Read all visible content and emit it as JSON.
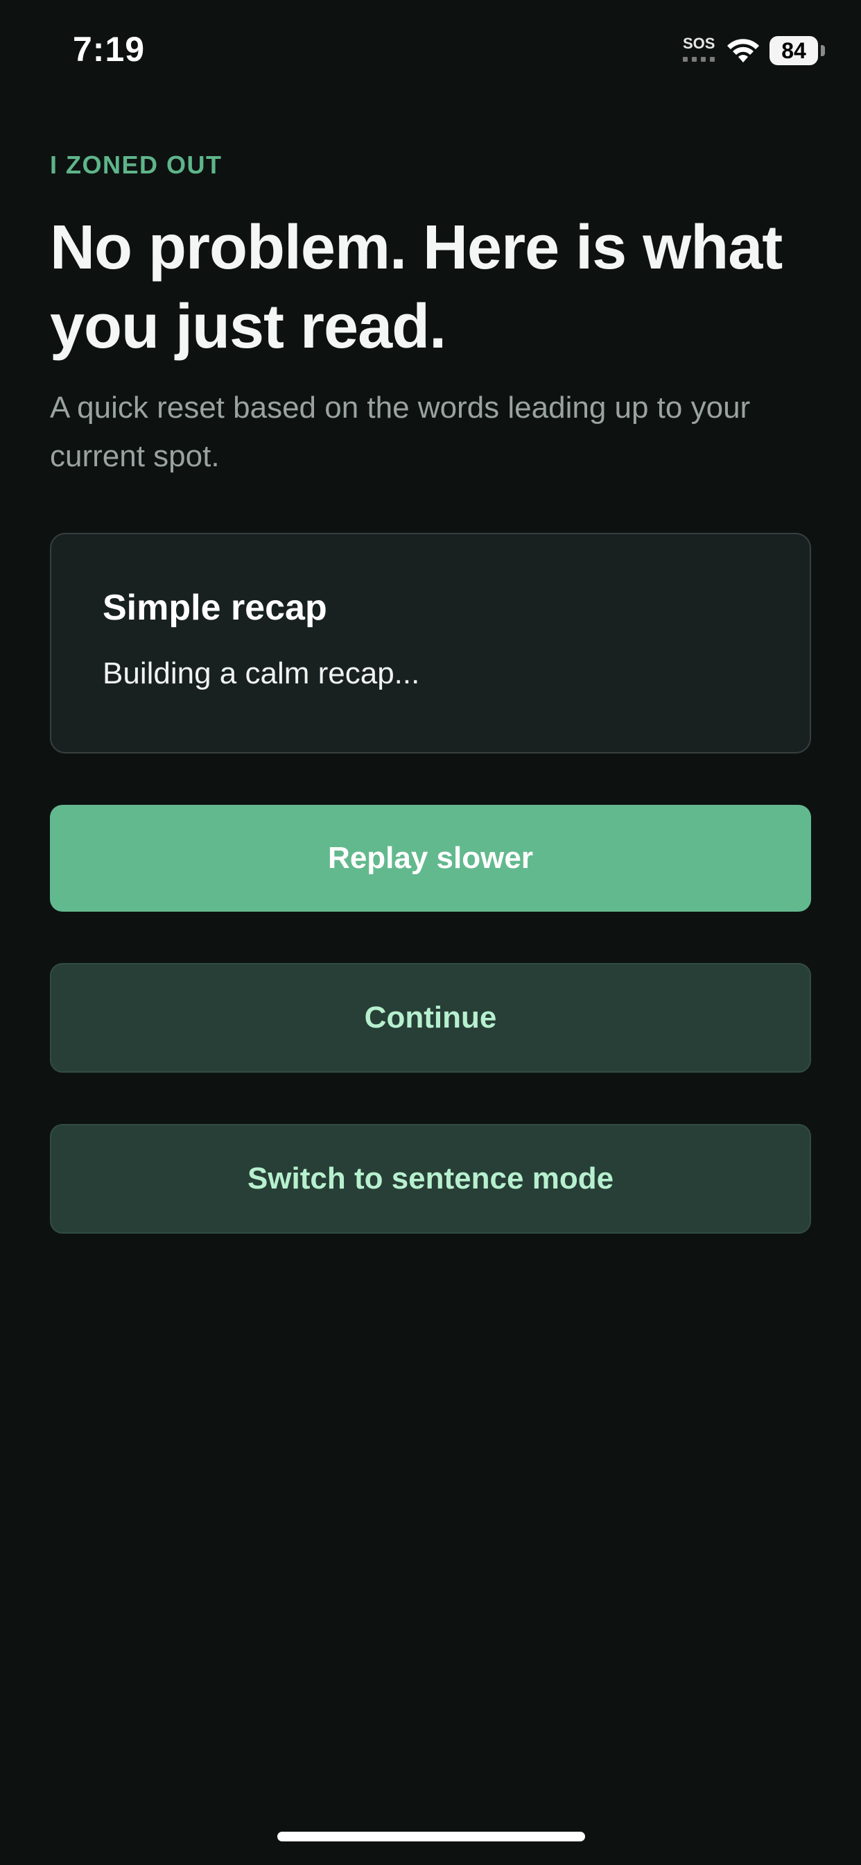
{
  "status_bar": {
    "time": "7:19",
    "sos": "SOS",
    "battery": "84"
  },
  "eyebrow": "I ZONED OUT",
  "title": "No problem. Here is what you just read.",
  "subtitle": "A quick reset based on the words leading up to your current spot.",
  "recap": {
    "title": "Simple recap",
    "body": "Building a calm recap..."
  },
  "buttons": {
    "replay": "Replay slower",
    "continue": "Continue",
    "sentence_mode": "Switch to sentence mode"
  },
  "colors": {
    "background": "#0d1211",
    "accent": "#63b98e",
    "eyebrow": "#5fb58a",
    "secondary_button": "#273f36",
    "secondary_text": "#b7f0cf"
  }
}
